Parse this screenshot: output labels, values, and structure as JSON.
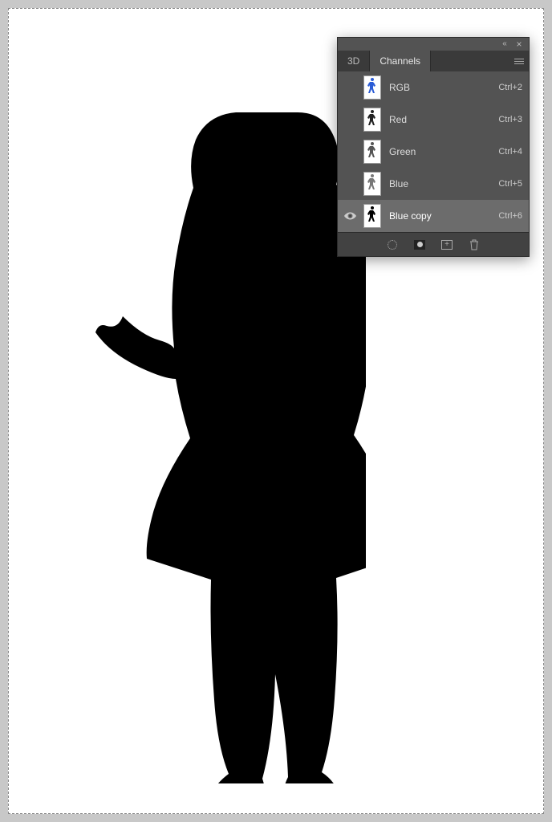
{
  "panel": {
    "tabs": [
      {
        "label": "3D",
        "active": false
      },
      {
        "label": "Channels",
        "active": true
      }
    ],
    "rows": [
      {
        "label": "RGB",
        "shortcut": "Ctrl+2",
        "visible": false,
        "selected": false,
        "color": "#2b5cd6"
      },
      {
        "label": "Red",
        "shortcut": "Ctrl+3",
        "visible": false,
        "selected": false,
        "color": "#222"
      },
      {
        "label": "Green",
        "shortcut": "Ctrl+4",
        "visible": false,
        "selected": false,
        "color": "#555"
      },
      {
        "label": "Blue",
        "shortcut": "Ctrl+5",
        "visible": false,
        "selected": false,
        "color": "#777"
      },
      {
        "label": "Blue copy",
        "shortcut": "Ctrl+6",
        "visible": true,
        "selected": true,
        "color": "#000"
      }
    ]
  }
}
